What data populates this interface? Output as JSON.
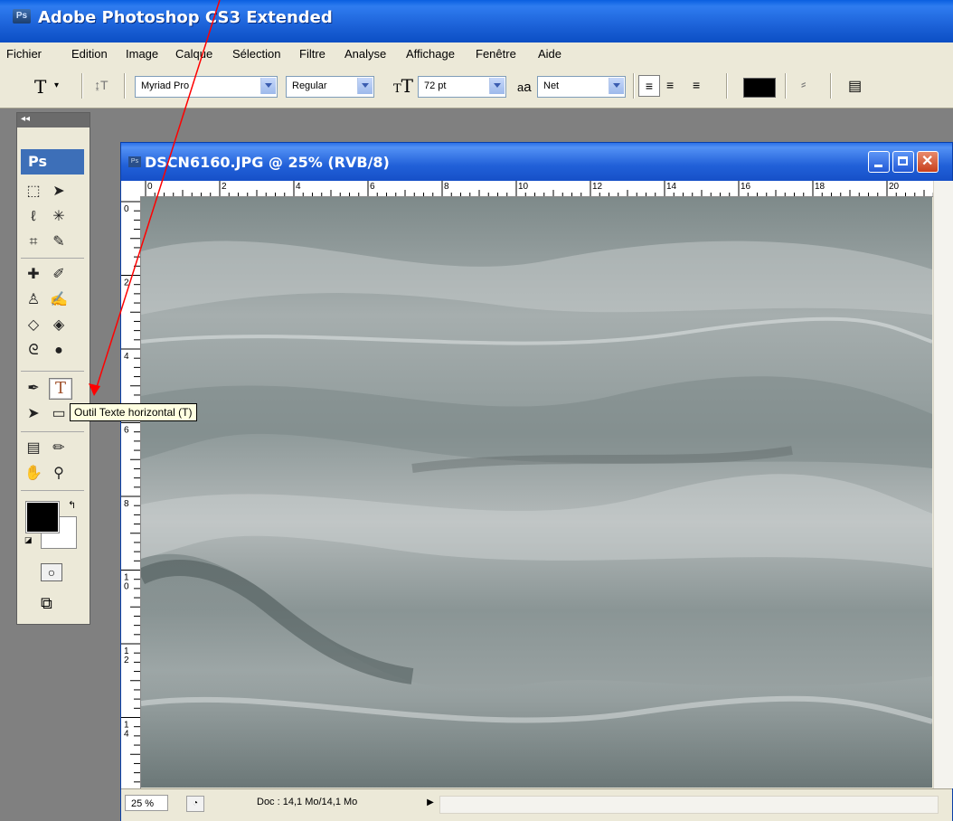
{
  "app": {
    "title": "Adobe Photoshop CS3 Extended",
    "badge": "Ps"
  },
  "menu": [
    "Fichier",
    "Edition",
    "Image",
    "Calque",
    "Sélection",
    "Filtre",
    "Analyse",
    "Affichage",
    "Fenêtre",
    "Aide"
  ],
  "options": {
    "tool_glyph": "T",
    "font_family": "Myriad Pro",
    "font_style": "Regular",
    "font_size": "72 pt",
    "antialias": "Net",
    "antialias_prefix": "a",
    "antialias_suffix": "a",
    "text_color": "#000000"
  },
  "tools_panel": {
    "collapse": "◂◂",
    "logo": "Ps"
  },
  "document": {
    "title": "DSCN6160.JPG @ 25% (RVB/8)",
    "ruler_top_labels": [
      "0",
      "2",
      "4",
      "6",
      "8",
      "10",
      "12",
      "14",
      "16",
      "18",
      "20"
    ],
    "ruler_left_labels": [
      "0",
      "2",
      "4",
      "6",
      "8",
      "10",
      "12",
      "14"
    ],
    "zoom": "25 %",
    "doc_info": "Doc : 14,1 Mo/14,1 Mo"
  },
  "tooltip": "Outil Texte horizontal (T)",
  "colors": {
    "annotation_arrow": "#ff0000",
    "title_bar": "#1c62d8"
  }
}
